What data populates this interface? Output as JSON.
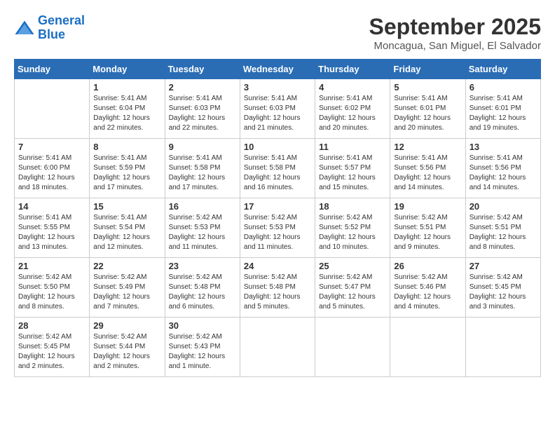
{
  "header": {
    "logo": {
      "line1": "General",
      "line2": "Blue"
    },
    "title": "September 2025",
    "subtitle": "Moncagua, San Miguel, El Salvador"
  },
  "weekdays": [
    "Sunday",
    "Monday",
    "Tuesday",
    "Wednesday",
    "Thursday",
    "Friday",
    "Saturday"
  ],
  "weeks": [
    [
      {
        "day": "",
        "info": ""
      },
      {
        "day": "1",
        "info": "Sunrise: 5:41 AM\nSunset: 6:04 PM\nDaylight: 12 hours\nand 22 minutes."
      },
      {
        "day": "2",
        "info": "Sunrise: 5:41 AM\nSunset: 6:03 PM\nDaylight: 12 hours\nand 22 minutes."
      },
      {
        "day": "3",
        "info": "Sunrise: 5:41 AM\nSunset: 6:03 PM\nDaylight: 12 hours\nand 21 minutes."
      },
      {
        "day": "4",
        "info": "Sunrise: 5:41 AM\nSunset: 6:02 PM\nDaylight: 12 hours\nand 20 minutes."
      },
      {
        "day": "5",
        "info": "Sunrise: 5:41 AM\nSunset: 6:01 PM\nDaylight: 12 hours\nand 20 minutes."
      },
      {
        "day": "6",
        "info": "Sunrise: 5:41 AM\nSunset: 6:01 PM\nDaylight: 12 hours\nand 19 minutes."
      }
    ],
    [
      {
        "day": "7",
        "info": "Sunrise: 5:41 AM\nSunset: 6:00 PM\nDaylight: 12 hours\nand 18 minutes."
      },
      {
        "day": "8",
        "info": "Sunrise: 5:41 AM\nSunset: 5:59 PM\nDaylight: 12 hours\nand 17 minutes."
      },
      {
        "day": "9",
        "info": "Sunrise: 5:41 AM\nSunset: 5:58 PM\nDaylight: 12 hours\nand 17 minutes."
      },
      {
        "day": "10",
        "info": "Sunrise: 5:41 AM\nSunset: 5:58 PM\nDaylight: 12 hours\nand 16 minutes."
      },
      {
        "day": "11",
        "info": "Sunrise: 5:41 AM\nSunset: 5:57 PM\nDaylight: 12 hours\nand 15 minutes."
      },
      {
        "day": "12",
        "info": "Sunrise: 5:41 AM\nSunset: 5:56 PM\nDaylight: 12 hours\nand 14 minutes."
      },
      {
        "day": "13",
        "info": "Sunrise: 5:41 AM\nSunset: 5:56 PM\nDaylight: 12 hours\nand 14 minutes."
      }
    ],
    [
      {
        "day": "14",
        "info": "Sunrise: 5:41 AM\nSunset: 5:55 PM\nDaylight: 12 hours\nand 13 minutes."
      },
      {
        "day": "15",
        "info": "Sunrise: 5:41 AM\nSunset: 5:54 PM\nDaylight: 12 hours\nand 12 minutes."
      },
      {
        "day": "16",
        "info": "Sunrise: 5:42 AM\nSunset: 5:53 PM\nDaylight: 12 hours\nand 11 minutes."
      },
      {
        "day": "17",
        "info": "Sunrise: 5:42 AM\nSunset: 5:53 PM\nDaylight: 12 hours\nand 11 minutes."
      },
      {
        "day": "18",
        "info": "Sunrise: 5:42 AM\nSunset: 5:52 PM\nDaylight: 12 hours\nand 10 minutes."
      },
      {
        "day": "19",
        "info": "Sunrise: 5:42 AM\nSunset: 5:51 PM\nDaylight: 12 hours\nand 9 minutes."
      },
      {
        "day": "20",
        "info": "Sunrise: 5:42 AM\nSunset: 5:51 PM\nDaylight: 12 hours\nand 8 minutes."
      }
    ],
    [
      {
        "day": "21",
        "info": "Sunrise: 5:42 AM\nSunset: 5:50 PM\nDaylight: 12 hours\nand 8 minutes."
      },
      {
        "day": "22",
        "info": "Sunrise: 5:42 AM\nSunset: 5:49 PM\nDaylight: 12 hours\nand 7 minutes."
      },
      {
        "day": "23",
        "info": "Sunrise: 5:42 AM\nSunset: 5:48 PM\nDaylight: 12 hours\nand 6 minutes."
      },
      {
        "day": "24",
        "info": "Sunrise: 5:42 AM\nSunset: 5:48 PM\nDaylight: 12 hours\nand 5 minutes."
      },
      {
        "day": "25",
        "info": "Sunrise: 5:42 AM\nSunset: 5:47 PM\nDaylight: 12 hours\nand 5 minutes."
      },
      {
        "day": "26",
        "info": "Sunrise: 5:42 AM\nSunset: 5:46 PM\nDaylight: 12 hours\nand 4 minutes."
      },
      {
        "day": "27",
        "info": "Sunrise: 5:42 AM\nSunset: 5:45 PM\nDaylight: 12 hours\nand 3 minutes."
      }
    ],
    [
      {
        "day": "28",
        "info": "Sunrise: 5:42 AM\nSunset: 5:45 PM\nDaylight: 12 hours\nand 2 minutes."
      },
      {
        "day": "29",
        "info": "Sunrise: 5:42 AM\nSunset: 5:44 PM\nDaylight: 12 hours\nand 2 minutes."
      },
      {
        "day": "30",
        "info": "Sunrise: 5:42 AM\nSunset: 5:43 PM\nDaylight: 12 hours\nand 1 minute."
      },
      {
        "day": "",
        "info": ""
      },
      {
        "day": "",
        "info": ""
      },
      {
        "day": "",
        "info": ""
      },
      {
        "day": "",
        "info": ""
      }
    ]
  ]
}
